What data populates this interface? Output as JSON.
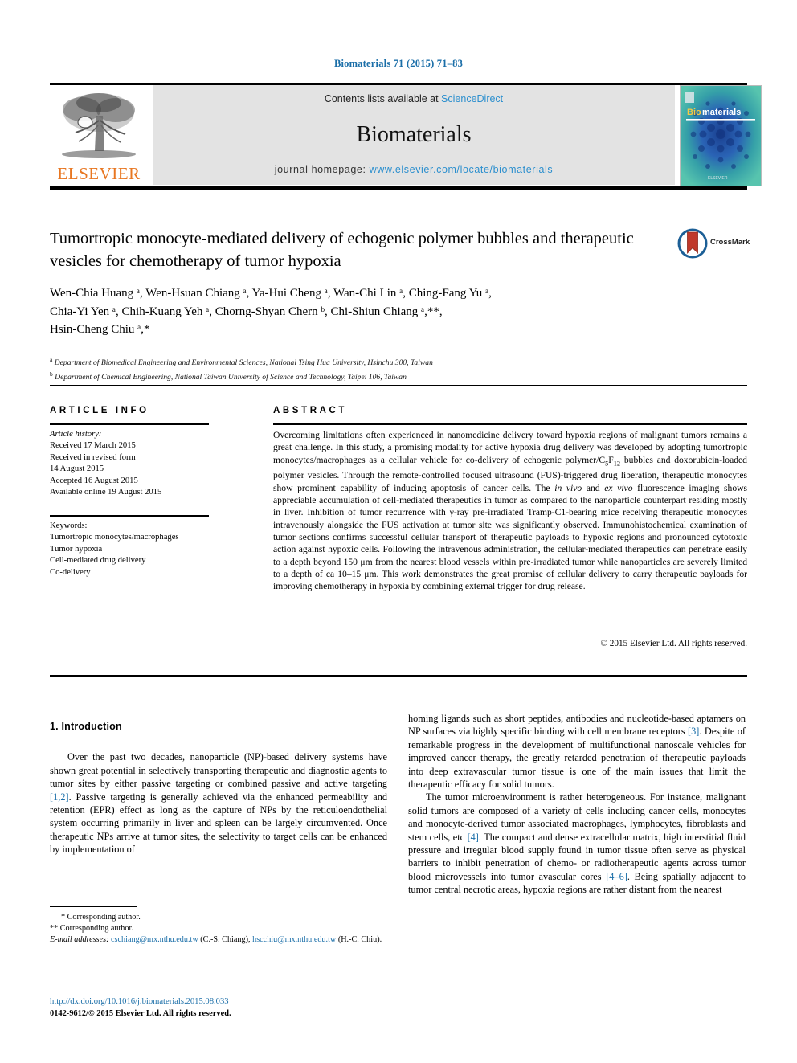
{
  "running_head": "Biomaterials 71 (2015) 71–83",
  "masthead": {
    "publisher": "ELSEVIER",
    "contents_prefix": "Contents lists available at ",
    "contents_link": "ScienceDirect",
    "journal_name": "Biomaterials",
    "homepage_prefix": "journal homepage: ",
    "homepage_url": "www.elsevier.com/locate/biomaterials",
    "cover_title_bio": "Bio",
    "cover_title_materials": "materials",
    "cover_footer": "ELSEVIER"
  },
  "title": "Tumortropic monocyte-mediated delivery of echogenic polymer bubbles and therapeutic vesicles for chemotherapy of tumor hypoxia",
  "crossmark_label": "CrossMark",
  "authors_line1": "Wen-Chia Huang ᵃ, Wen-Hsuan Chiang ᵃ, Ya-Hui Cheng ᵃ, Wan-Chi Lin ᵃ, Ching-Fang Yu ᵃ,",
  "authors_line2": "Chia-Yi Yen ᵃ, Chih-Kuang Yeh ᵃ, Chorng-Shyan Chern ᵇ, Chi-Shiun Chiang ᵃ,**,",
  "authors_line3": "Hsin-Cheng Chiu ᵃ,*",
  "affiliation_a": "Department of Biomedical Engineering and Environmental Sciences, National Tsing Hua University, Hsinchu 300, Taiwan",
  "affiliation_b": "Department of Chemical Engineering, National Taiwan University of Science and Technology, Taipei 106, Taiwan",
  "affiliation_a_mark": "a",
  "affiliation_b_mark": "b",
  "info_heading": "ARTICLE INFO",
  "abstract_heading": "ABSTRACT",
  "article_history": {
    "label": "Article history:",
    "lines": [
      "Received 17 March 2015",
      "Received in revised form",
      "14 August 2015",
      "Accepted 16 August 2015",
      "Available online 19 August 2015"
    ]
  },
  "keywords": {
    "label": "Keywords:",
    "items": [
      "Tumortropic monocytes/macrophages",
      "Tumor hypoxia",
      "Cell-mediated drug delivery",
      "Co-delivery"
    ]
  },
  "abstract": {
    "p1": "Overcoming limitations often experienced in nanomedicine delivery toward hypoxia regions of malignant tumors remains a great challenge. In this study, a promising modality for active hypoxia drug delivery was developed by adopting tumortropic monocytes/macrophages as a cellular vehicle for co-delivery of echogenic polymer/C",
    "sub1": "5",
    "p1b": "F",
    "sub2": "12",
    "p1c": " bubbles and doxorubicin-loaded polymer vesicles. Through the remote-controlled focused ultrasound (FUS)-triggered drug liberation, therapeutic monocytes show prominent capability of inducing apoptosis of cancer cells. The ",
    "em1": "in vivo",
    "p1d": " and ",
    "em2": "ex vivo",
    "p1e": " fluorescence imaging shows appreciable accumulation of cell-mediated therapeutics in tumor as compared to the nanoparticle counterpart residing mostly in liver. Inhibition of tumor recurrence with γ-ray pre-irradiated Tramp-C1-bearing mice receiving therapeutic monocytes intravenously alongside the FUS activation at tumor site was significantly observed. Immunohistochemical examination of tumor sections confirms successful cellular transport of therapeutic payloads to hypoxic regions and pronounced cytotoxic action against hypoxic cells. Following the intravenous administration, the cellular-mediated therapeutics can penetrate easily to a depth beyond 150 μm from the nearest blood vessels within pre-irradiated tumor while nanoparticles are severely limited to a depth of ca 10–15 μm. This work demonstrates the great promise of cellular delivery to carry therapeutic payloads for improving chemotherapy in hypoxia by combining external trigger for drug release.",
    "copyright": "© 2015 Elsevier Ltd. All rights reserved."
  },
  "body": {
    "section_number_title": "1. Introduction",
    "left_p1_a": "Over the past two decades, nanoparticle (NP)-based delivery systems have shown great potential in selectively transporting therapeutic and diagnostic agents to tumor sites by either passive targeting or combined passive and active targeting ",
    "left_p1_ref": "[1,2]",
    "left_p1_b": ". Passive targeting is generally achieved via the enhanced permeability and retention (EPR) effect as long as the capture of NPs by the reticuloendothelial system occurring primarily in liver and spleen can be largely circumvented. Once therapeutic NPs arrive at tumor sites, the selectivity to target cells can be enhanced by implementation of",
    "right_p1_a": "homing ligands such as short peptides, antibodies and nucleotide-based aptamers on NP surfaces via highly specific binding with cell membrane receptors ",
    "right_p1_ref": "[3]",
    "right_p1_b": ". Despite of remarkable progress in the development of multifunctional nanoscale vehicles for improved cancer therapy, the greatly retarded penetration of therapeutic payloads into deep extravascular tumor tissue is one of the main issues that limit the therapeutic efficacy for solid tumors.",
    "right_p2_a": "The tumor microenvironment is rather heterogeneous. For instance, malignant solid tumors are composed of a variety of cells including cancer cells, monocytes and monocyte-derived tumor associated macrophages, lymphocytes, fibroblasts and stem cells, etc ",
    "right_p2_ref1": "[4]",
    "right_p2_b": ". The compact and dense extracellular matrix, high interstitial fluid pressure and irregular blood supply found in tumor tissue often serve as physical barriers to inhibit penetration of chemo- or radiotherapeutic agents across tumor blood microvessels into tumor avascular cores ",
    "right_p2_ref2": "[4–6]",
    "right_p2_c": ". Being spatially adjacent to tumor central necrotic areas, hypoxia regions are rather distant from the nearest"
  },
  "footnotes": {
    "star_line": "* Corresponding author.",
    "dblstar_line": "** Corresponding author.",
    "email_label": "E-mail addresses:",
    "email1": "cschiang@mx.nthu.edu.tw",
    "email1_name": " (C.-S. Chiang), ",
    "email2": "hscchiu@mx.nthu.edu.tw",
    "email2_name": " (H.-C. Chiu)."
  },
  "doi": {
    "url": "http://dx.doi.org/10.1016/j.biomaterials.2015.08.033",
    "issn": "0142-9612/© 2015 Elsevier Ltd. All rights reserved."
  },
  "colors": {
    "link": "#1a6ea8",
    "sd_link": "#2c8fce",
    "elsevier_orange": "#E87722",
    "panel_grey": "#e3e3e3"
  }
}
